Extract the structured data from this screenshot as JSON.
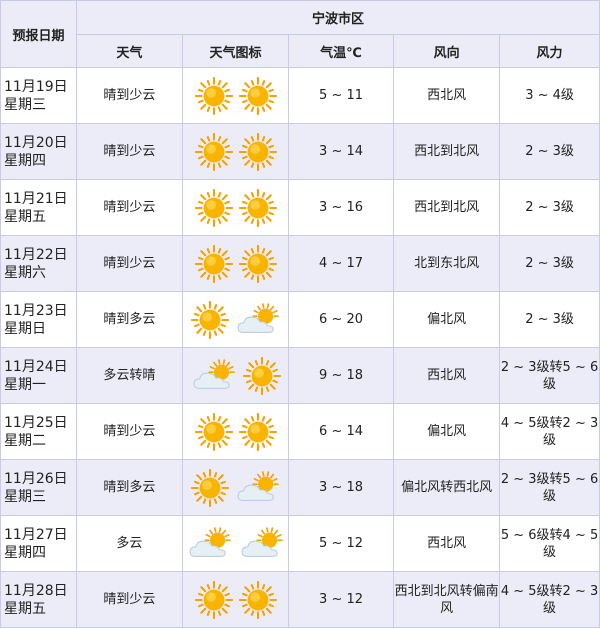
{
  "header": {
    "date_label": "预报日期",
    "region": "宁波市区",
    "columns": [
      "天气",
      "天气图标",
      "气温℃",
      "风向",
      "风力"
    ]
  },
  "rows": [
    {
      "date": "11月19日",
      "weekday": "星期三",
      "weather": "晴到少云",
      "icons": [
        "sun-icon",
        "sun-icon"
      ],
      "temp": "5 ~ 11",
      "wind_dir": "西北风",
      "wind_power": "3 ~ 4级"
    },
    {
      "date": "11月20日",
      "weekday": "星期四",
      "weather": "晴到少云",
      "icons": [
        "sun-icon",
        "sun-icon"
      ],
      "temp": "3 ~ 14",
      "wind_dir": "西北到北风",
      "wind_power": "2 ~ 3级"
    },
    {
      "date": "11月21日",
      "weekday": "星期五",
      "weather": "晴到少云",
      "icons": [
        "sun-icon",
        "sun-icon"
      ],
      "temp": "3 ~ 16",
      "wind_dir": "西北到北风",
      "wind_power": "2 ~ 3级"
    },
    {
      "date": "11月22日",
      "weekday": "星期六",
      "weather": "晴到少云",
      "icons": [
        "sun-icon",
        "sun-icon"
      ],
      "temp": "4 ~ 17",
      "wind_dir": "北到东北风",
      "wind_power": "2 ~ 3级"
    },
    {
      "date": "11月23日",
      "weekday": "星期日",
      "weather": "晴到多云",
      "icons": [
        "sun-icon",
        "cloud-sun-icon"
      ],
      "temp": "6 ~ 20",
      "wind_dir": "偏北风",
      "wind_power": "2 ~ 3级"
    },
    {
      "date": "11月24日",
      "weekday": "星期一",
      "weather": "多云转晴",
      "icons": [
        "cloud-sun-icon",
        "sun-icon"
      ],
      "temp": "9 ~ 18",
      "wind_dir": "西北风",
      "wind_power": "2 ~ 3级转5 ~ 6级"
    },
    {
      "date": "11月25日",
      "weekday": "星期二",
      "weather": "晴到少云",
      "icons": [
        "sun-icon",
        "sun-icon"
      ],
      "temp": "6 ~ 14",
      "wind_dir": "偏北风",
      "wind_power": "4 ~ 5级转2 ~ 3级"
    },
    {
      "date": "11月26日",
      "weekday": "星期三",
      "weather": "晴到多云",
      "icons": [
        "sun-icon",
        "cloud-sun-icon"
      ],
      "temp": "3 ~ 18",
      "wind_dir": "偏北风转西北风",
      "wind_power": "2 ~ 3级转5 ~ 6级"
    },
    {
      "date": "11月27日",
      "weekday": "星期四",
      "weather": "多云",
      "icons": [
        "cloud-sun-icon",
        "cloud-sun-icon"
      ],
      "temp": "5 ~ 12",
      "wind_dir": "西北风",
      "wind_power": "5 ~ 6级转4 ~ 5级"
    },
    {
      "date": "11月28日",
      "weekday": "星期五",
      "weather": "晴到少云",
      "icons": [
        "sun-icon",
        "sun-icon"
      ],
      "temp": "3 ~ 12",
      "wind_dir": "西北到北风转偏南风",
      "wind_power": "4 ~ 5级转2 ~ 3级"
    }
  ],
  "colors": {
    "header_bg": "#ececf8",
    "stripe_bg": "#ececf8",
    "border": "#c9cbe6",
    "sun": "#f5a300",
    "cloud": "#dfe8f2"
  }
}
